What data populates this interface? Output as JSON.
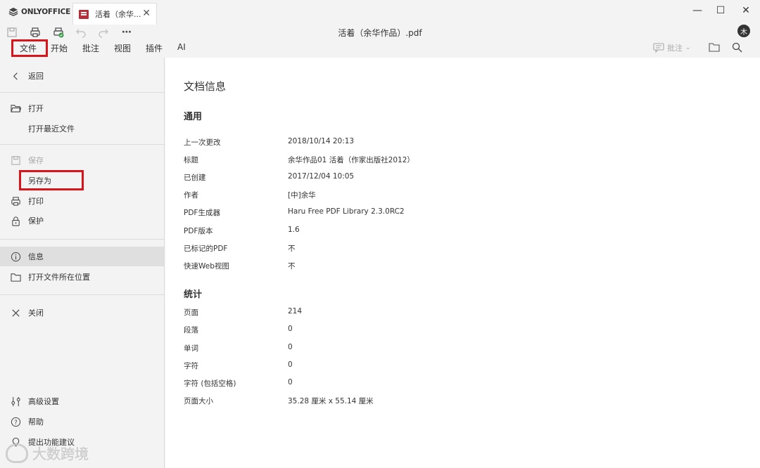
{
  "app": {
    "logo": "ONLYOFFICE"
  },
  "tab": {
    "title": "活着（余华..."
  },
  "document": {
    "title": "活着（余华作品）.pdf"
  },
  "user": {
    "avatar_initial": "木"
  },
  "menu": {
    "items": [
      "文件",
      "开始",
      "批注",
      "视图",
      "插件",
      "AI"
    ]
  },
  "right_tools": {
    "comments_label": "批注"
  },
  "left_panel": {
    "back": "返回",
    "open": "打开",
    "open_recent": "打开最近文件",
    "save": "保存",
    "save_as": "另存为",
    "print": "打印",
    "protect": "保护",
    "info": "信息",
    "open_location": "打开文件所在位置",
    "close": "关闭",
    "advanced_settings": "高级设置",
    "help": "帮助",
    "feedback": "提出功能建议"
  },
  "info_panel": {
    "heading": "文档信息",
    "general_title": "通用",
    "general": [
      {
        "label": "上一次更改",
        "value": "2018/10/14 20:13"
      },
      {
        "label": "标题",
        "value": "余华作品01 活着（作家出版社2012）"
      },
      {
        "label": "已创建",
        "value": "2017/12/04 10:05"
      },
      {
        "label": "作者",
        "value": "[中]余华"
      },
      {
        "label": "PDF生成器",
        "value": "Haru Free PDF Library 2.3.0RC2"
      },
      {
        "label": "PDF版本",
        "value": "1.6"
      },
      {
        "label": "已标记的PDF",
        "value": "不"
      },
      {
        "label": "快速Web视图",
        "value": "不"
      }
    ],
    "stats_title": "统计",
    "stats": [
      {
        "label": "页面",
        "value": "214"
      },
      {
        "label": "段落",
        "value": "0"
      },
      {
        "label": "单词",
        "value": "0"
      },
      {
        "label": "字符",
        "value": "0"
      },
      {
        "label": "字符 (包括空格)",
        "value": "0"
      },
      {
        "label": "页面大小",
        "value": "35.28 厘米 x 55.14 厘米"
      }
    ]
  },
  "watermark": {
    "text": "大数跨境"
  },
  "colors": {
    "highlight": "#d9141b",
    "pdf_icon": "#b3303a"
  }
}
